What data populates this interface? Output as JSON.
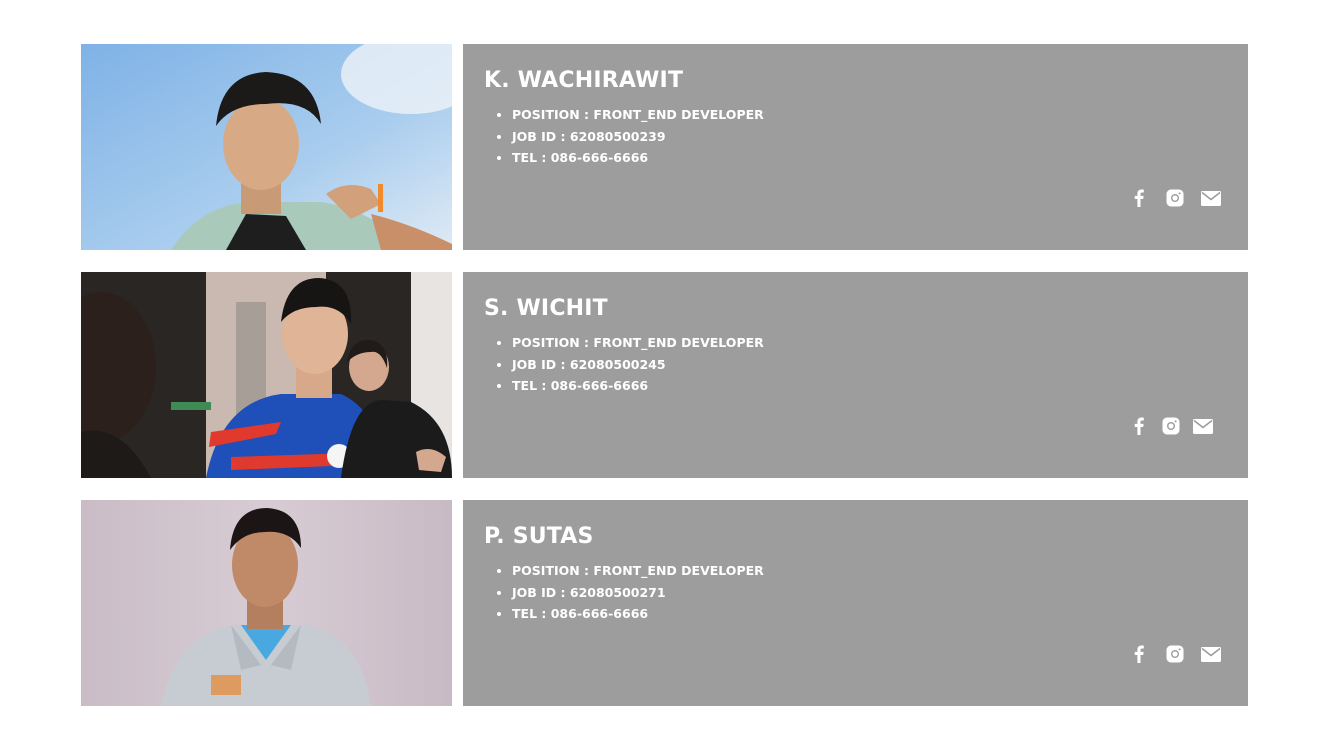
{
  "members": [
    {
      "name": "K. WACHIRAWIT",
      "position": "POSITION : FRONT_END DEVELOPER",
      "job_id": "JOB ID : 62080500239",
      "tel": "TEL : 086-666-6666",
      "socials": [
        "facebook-icon",
        "instagram-icon",
        "mail-icon"
      ]
    },
    {
      "name": "S. WICHIT",
      "position": "POSITION : FRONT_END DEVELOPER",
      "job_id": "JOB ID : 62080500245",
      "tel": "TEL : 086-666-6666",
      "socials": [
        "facebook-icon",
        "instagram-icon",
        "mail-icon"
      ]
    },
    {
      "name": "P. SUTAS",
      "position": "POSITION : FRONT_END DEVELOPER",
      "job_id": "JOB ID : 62080500271",
      "tel": "TEL : 086-666-6666",
      "socials": [
        "facebook-icon",
        "instagram-icon",
        "mail-icon"
      ]
    }
  ],
  "colors": {
    "card_background": "#9d9d9d",
    "text": "#ffffff",
    "page_background": "#ffffff"
  }
}
